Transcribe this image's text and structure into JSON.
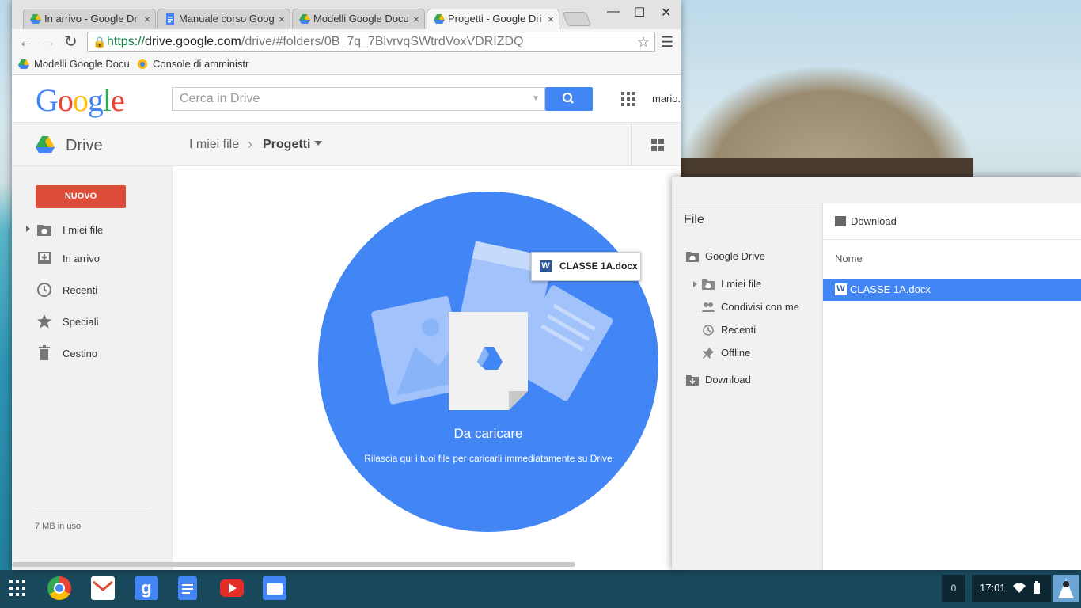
{
  "browser": {
    "tabs": [
      {
        "label": "In arrivo - Google Dr",
        "icon": "google-drive-icon"
      },
      {
        "label": "Manuale corso Goog",
        "icon": "google-docs-icon"
      },
      {
        "label": "Modelli Google Docu",
        "icon": "google-drive-icon"
      },
      {
        "label": "Progetti - Google Dri",
        "icon": "google-drive-icon",
        "active": true
      }
    ],
    "tab_close": "×",
    "url_scheme": "https://",
    "url_host": "drive.google.com",
    "url_path": "/drive/#folders/0B_7q_7BlvrvqSWtrdVoxVDRIZDQ",
    "bookmarks": [
      {
        "label": "Modelli Google Docu",
        "icon": "google-drive-icon"
      },
      {
        "label": "Console di amministr",
        "icon": "admin-console-icon"
      }
    ]
  },
  "drive": {
    "logo_text": "Google",
    "search_placeholder": "Cerca in Drive",
    "user": "mario.",
    "title": "Drive",
    "breadcrumb_root": "I miei file",
    "breadcrumb_current": "Progetti",
    "new_button": "NUOVO",
    "nav": [
      {
        "label": "I miei file",
        "icon": "my-drive-icon"
      },
      {
        "label": "In arrivo",
        "icon": "incoming-icon"
      },
      {
        "label": "Recenti",
        "icon": "clock-icon"
      },
      {
        "label": "Speciali",
        "icon": "star-icon"
      },
      {
        "label": "Cestino",
        "icon": "trash-icon"
      }
    ],
    "storage": "7 MB in uso",
    "drop_title": "Da caricare",
    "drop_subtitle": "Rilascia qui i tuoi file per caricarli immediatamente su Drive",
    "dragged_file": "CLASSE 1A.docx"
  },
  "files_app": {
    "heading": "File",
    "sidebar": [
      {
        "label": "Google Drive",
        "icon": "google-drive-folder-icon"
      },
      {
        "label": "I miei file",
        "icon": "my-drive-icon"
      },
      {
        "label": "Condivisi con me",
        "icon": "shared-icon"
      },
      {
        "label": "Recenti",
        "icon": "clock-icon"
      },
      {
        "label": "Offline",
        "icon": "pin-icon"
      },
      {
        "label": "Download",
        "icon": "download-folder-icon"
      }
    ],
    "current_folder": "Download",
    "column_name": "Nome",
    "selected_file": "CLASSE 1A.docx"
  },
  "shelf": {
    "apps": [
      "chrome-icon",
      "gmail-icon",
      "google-search-icon",
      "docs-icon",
      "youtube-icon",
      "files-icon"
    ],
    "notifications": "0",
    "time": "17:01"
  }
}
